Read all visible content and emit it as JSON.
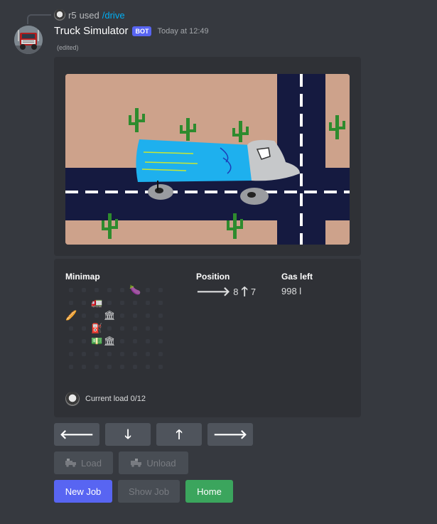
{
  "reply": {
    "user": "r5",
    "used": "used",
    "command": "/drive"
  },
  "message": {
    "username": "Truck Simulator",
    "badge": "BOT",
    "timestamp": "Today at 12:49",
    "edited": "(edited)"
  },
  "stats": {
    "minimap_label": "Minimap",
    "position_label": "Position",
    "position_x": "8",
    "position_y": "7",
    "gas_label": "Gas left",
    "gas_value": "998 l",
    "footer": "Current load 0/12"
  },
  "minimap_icons": [
    {
      "name": "eggplant-icon",
      "emoji": "🍆"
    },
    {
      "name": "truck-player-icon",
      "emoji": "🚛"
    },
    {
      "name": "bread-icon",
      "emoji": "🥖"
    },
    {
      "name": "bank-icon",
      "emoji": "🏛"
    },
    {
      "name": "fuel-pump-icon",
      "emoji": "⛽"
    },
    {
      "name": "bank-icon",
      "emoji": "🏛"
    },
    {
      "name": "money-icon",
      "emoji": "💵"
    }
  ],
  "controls": {
    "left": "🡐",
    "down": "🡓",
    "up": "🡑",
    "right": "🡒",
    "load": "Load",
    "unload": "Unload",
    "new_job": "New Job",
    "show_job": "Show Job",
    "home": "Home"
  },
  "colors": {
    "background": "#36393f",
    "embed": "#2f3136",
    "blurple": "#5865f2",
    "green": "#3ba55d",
    "sand": "#cda28b",
    "road": "#151a40",
    "truck_blue": "#1eb0ee"
  }
}
